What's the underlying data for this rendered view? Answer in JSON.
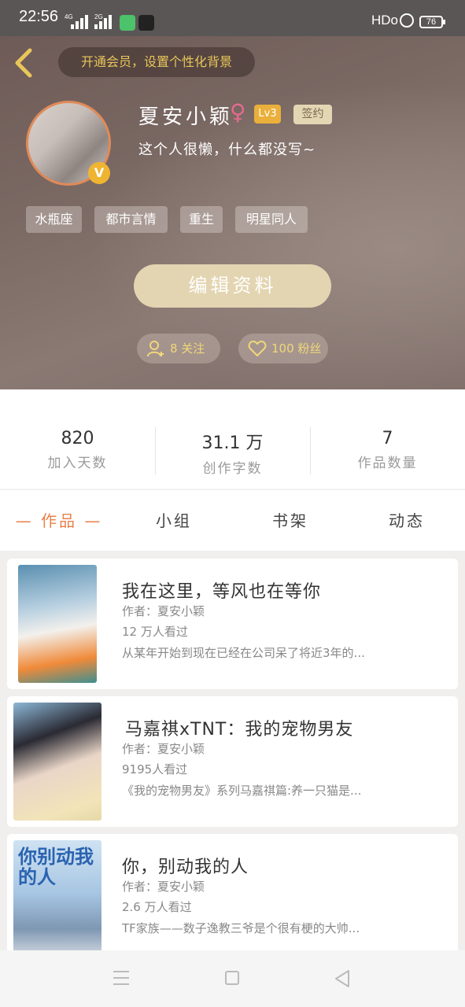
{
  "status_bar": {
    "time": "22:56",
    "net1": "4G",
    "net2": "2G",
    "hd": "HDo",
    "battery": "76"
  },
  "header": {
    "vip_prompt": "开通会员，设置个性化背景",
    "avatar_badge": "V",
    "username": "夏安小颖",
    "gender_icon": "♀",
    "level": "Lv3",
    "signed": "签约",
    "bio": "这个人很懒，什么都没写~",
    "tags": [
      "水瓶座",
      "都市言情",
      "重生",
      "明星同人"
    ],
    "edit_button": "编辑资料",
    "follow": "8 关注",
    "fans": "100 粉丝"
  },
  "stats": [
    {
      "value": "820",
      "label": "加入天数"
    },
    {
      "value": "31.1 万",
      "label": "创作字数"
    },
    {
      "value": "7",
      "label": "作品数量"
    }
  ],
  "tabs": [
    "— 作品 —",
    "小组",
    "书架",
    "动态"
  ],
  "works": [
    {
      "title": "我在这里，等风也在等你",
      "author": "作者：夏安小颖",
      "views": "12 万人看过",
      "desc": "从某年开始到现在已经在公司呆了将近3年的..."
    },
    {
      "title": "马嘉祺xTNT：我的宠物男友",
      "author": "作者：夏安小颖",
      "views": "9195人看过",
      "desc": "《我的宠物男友》系列马嘉祺篇:养一只猫是..."
    },
    {
      "title": "你，别动我的人",
      "author": "作者：夏安小颖",
      "views": "2.6 万人看过",
      "desc": "TF家族——数子逸教三爷是个很有梗的大帅...",
      "cover_text": "你别动我的人"
    }
  ],
  "colors": {
    "accent": "#e8804a",
    "gold": "#e8c65a",
    "edit_button": "#e3d5b1"
  }
}
